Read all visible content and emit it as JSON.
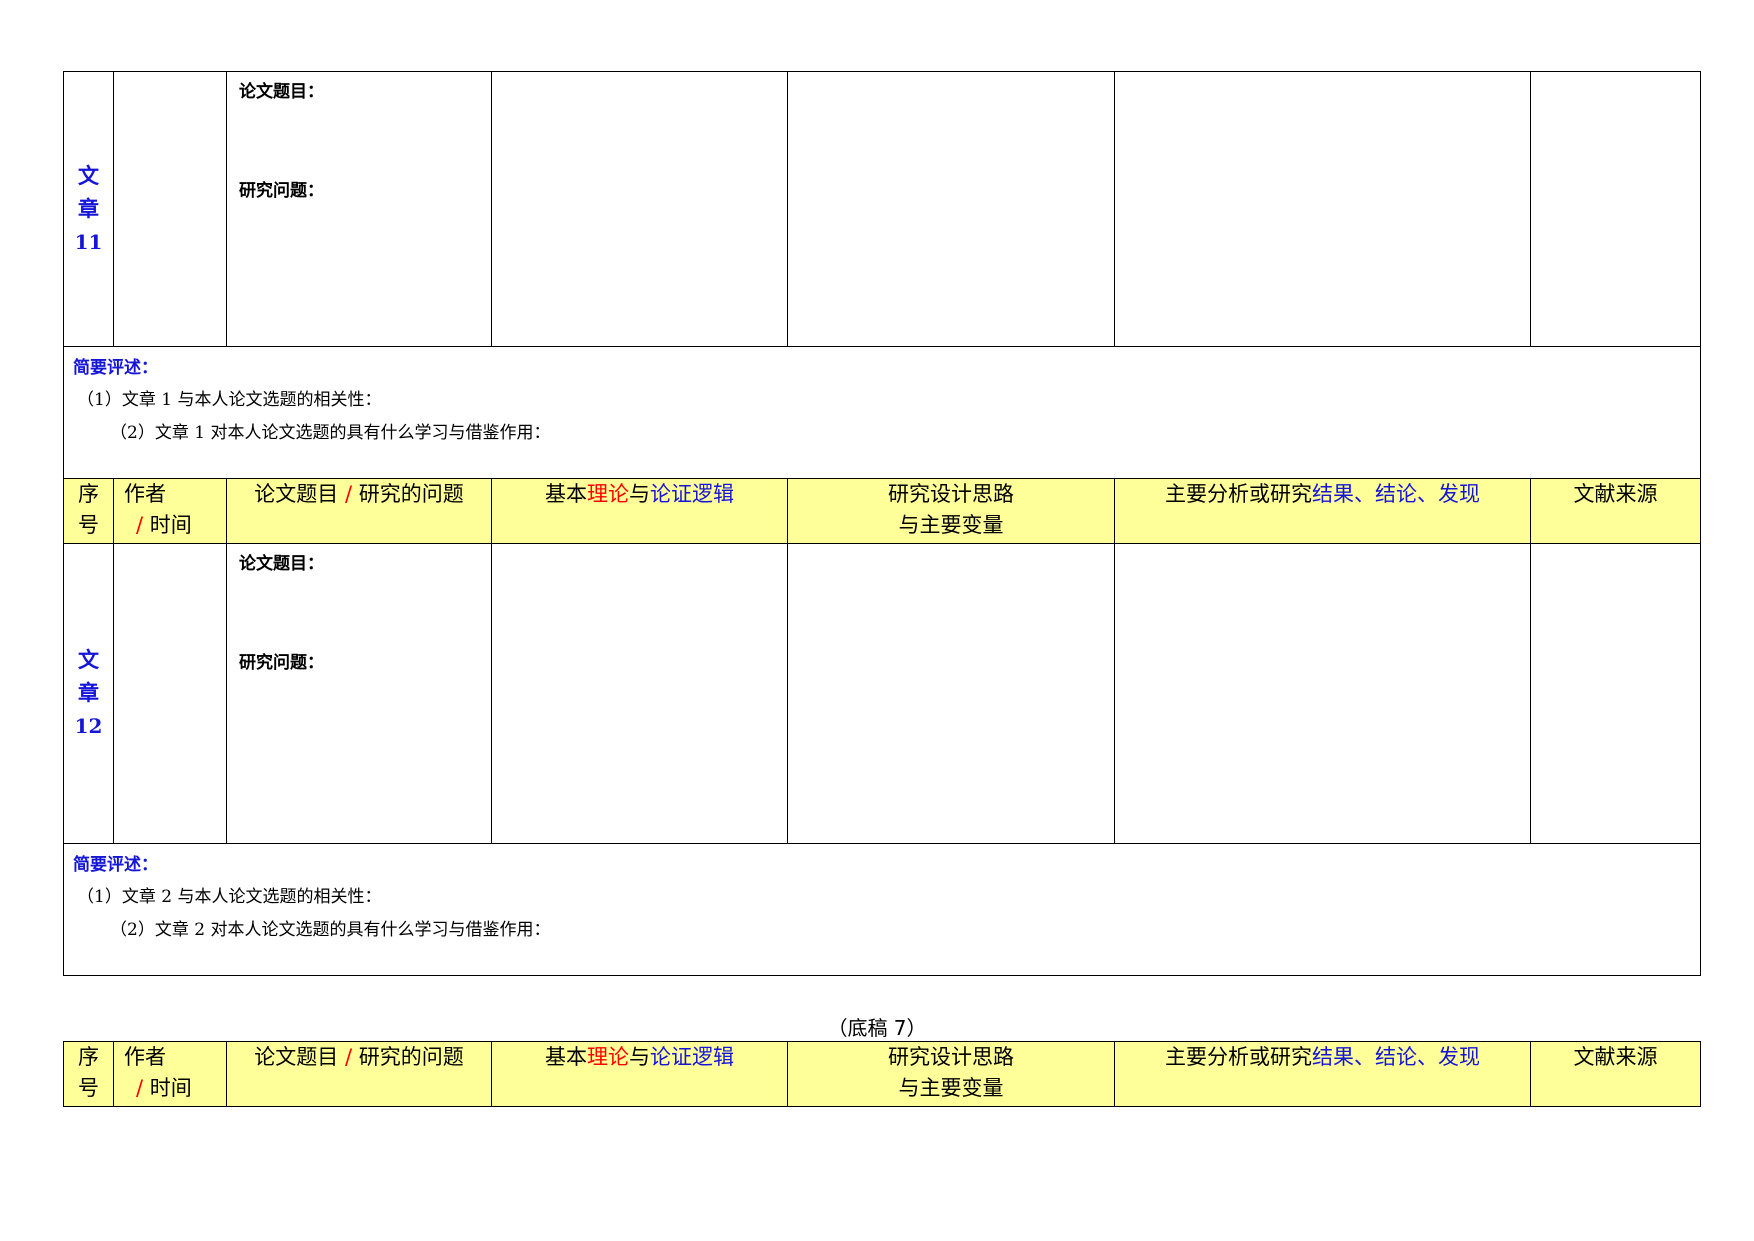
{
  "header": {
    "seq": [
      "序",
      "号"
    ],
    "author": [
      "作者",
      "/",
      "时间"
    ],
    "title_q": [
      "论文题目",
      "/",
      "研究的问题"
    ],
    "theory": [
      "基本",
      "理论",
      "与",
      "论证逻辑"
    ],
    "design": [
      "研究设计思路",
      "与主要变量"
    ],
    "findings": [
      "主要分析或研究",
      "结果、结论、发现"
    ],
    "source": "文献来源"
  },
  "article_11": {
    "label": [
      "文",
      "章",
      "11"
    ],
    "title_label": "论文题目：",
    "question_label": "研究问题："
  },
  "review_1": {
    "heading": "简要评述：",
    "line1": "（1）文章 1 与本人论文选题的相关性：",
    "line2": "（2）文章 1 对本人论文选题的具有什么学习与借鉴作用："
  },
  "article_12": {
    "label": [
      "文",
      "章",
      "12"
    ],
    "title_label": "论文题目：",
    "question_label": "研究问题："
  },
  "review_2": {
    "heading": "简要评述：",
    "line1": "（1）文章 2 与本人论文选题的相关性：",
    "line2": "（2）文章 2 对本人论文选题的具有什么学习与借鉴作用："
  },
  "footer": {
    "draft_label": "（底稿 7）"
  },
  "colors": {
    "header_bg": "#ffff99",
    "accent_blue": "#1515d8",
    "accent_red": "#ff0000"
  }
}
